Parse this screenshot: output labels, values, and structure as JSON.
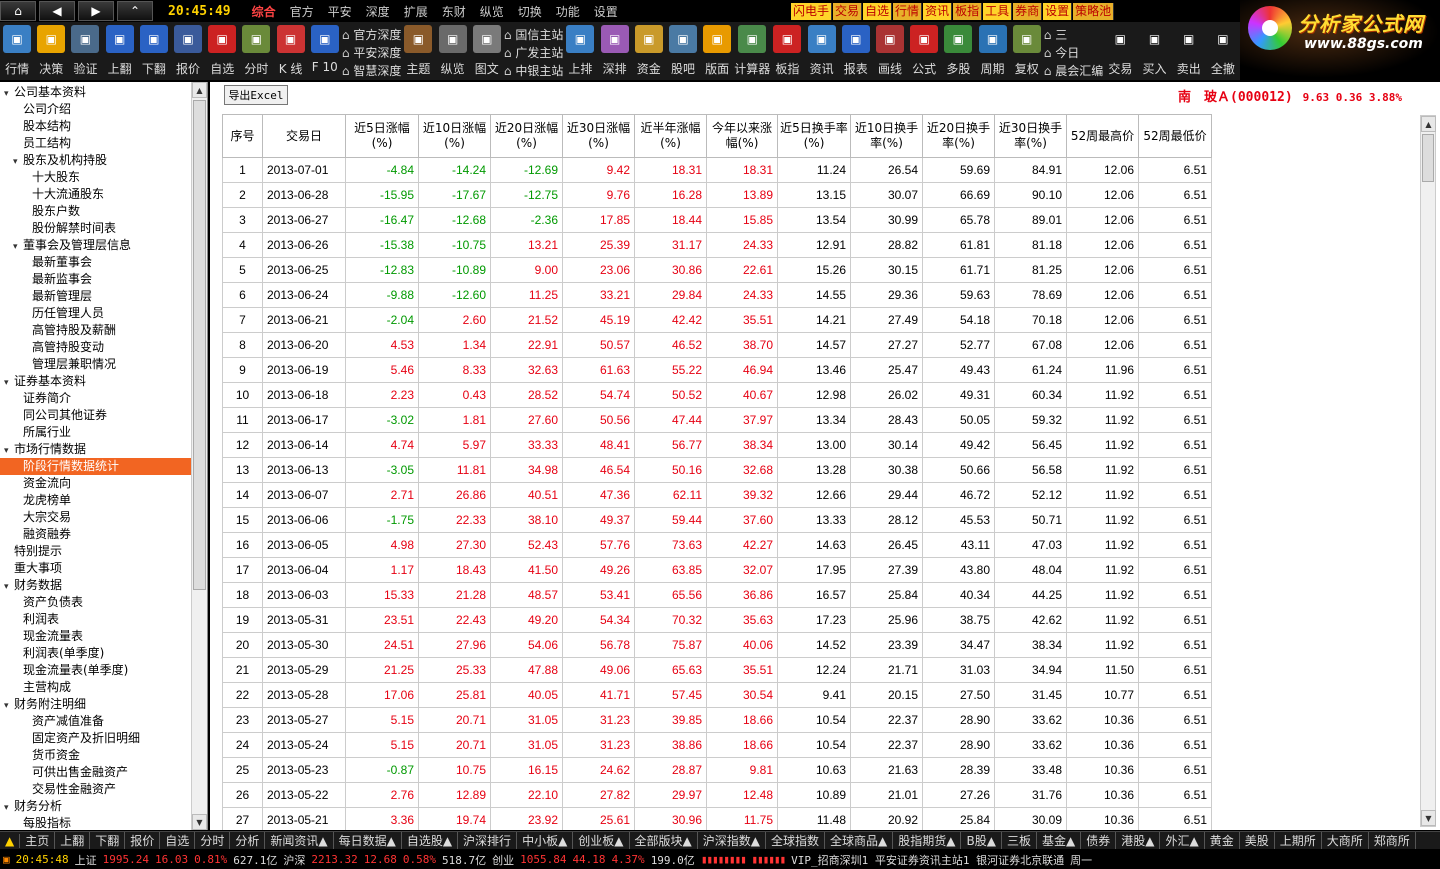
{
  "topbar": {
    "clock": "20:45:49",
    "menus": [
      "综合",
      "官方",
      "平安",
      "深度",
      "扩展",
      "东财",
      "纵览",
      "切换",
      "功能",
      "设置"
    ],
    "quick": [
      "闪电手",
      "交易",
      "自选",
      "行情",
      "资讯",
      "板指",
      "工具",
      "券商",
      "设置",
      "策略池"
    ]
  },
  "logo": {
    "title": "分析家公式网",
    "url": "www.88gs.com"
  },
  "toolbar": {
    "tools1": [
      {
        "label": "行情",
        "color": "#3a7fc4"
      },
      {
        "label": "决策",
        "color": "#e8a400"
      },
      {
        "label": "验证",
        "color": "#4a6a8a"
      },
      {
        "label": "上翻",
        "color": "#2a62c4"
      },
      {
        "label": "下翻",
        "color": "#2a62c4"
      },
      {
        "label": "报价",
        "color": "#3a5a9a"
      },
      {
        "label": "自选",
        "color": "#c22"
      },
      {
        "label": "分时",
        "color": "#6a8a3a"
      },
      {
        "label": "K 线",
        "color": "#c33"
      },
      {
        "label": "F 10",
        "color": "#2a62c4"
      }
    ],
    "triple1": [
      "官方深度",
      "平安深度",
      "智慧深度"
    ],
    "tools2": [
      {
        "label": "主题",
        "color": "#8a5a2a"
      },
      {
        "label": "纵览",
        "color": "#6a6a6a"
      },
      {
        "label": "图文",
        "color": "#7a7a7a"
      }
    ],
    "triple2": [
      "国信主站",
      "广发主站",
      "中银主站"
    ],
    "tools3": [
      {
        "label": "上排",
        "color": "#3a7fc4"
      },
      {
        "label": "深排",
        "color": "#9a5ab4"
      },
      {
        "label": "资金",
        "color": "#c99a2a"
      },
      {
        "label": "股吧",
        "color": "#4a7aa4"
      },
      {
        "label": "版面",
        "color": "#e89a00"
      },
      {
        "label": "计算器",
        "color": "#4a8a4a"
      },
      {
        "label": "板指",
        "color": "#c22"
      },
      {
        "label": "资讯",
        "color": "#3a7fc4"
      },
      {
        "label": "报表",
        "color": "#2a62c4"
      },
      {
        "label": "画线",
        "color": "#a33"
      },
      {
        "label": "公式",
        "color": "#c22"
      },
      {
        "label": "多股",
        "color": "#3a8a3a"
      },
      {
        "label": "周期",
        "color": "#2a72b4"
      },
      {
        "label": "复权",
        "color": "#6a8a3a"
      }
    ],
    "triple3": [
      "三",
      "今日",
      "晨会汇编"
    ],
    "tools4": [
      {
        "label": "交易",
        "color": "#1a1a1a"
      },
      {
        "label": "买入",
        "color": "#1a1a1a"
      },
      {
        "label": "卖出",
        "color": "#1a1a1a"
      },
      {
        "label": "全撤",
        "color": "#1a1a1a"
      }
    ]
  },
  "sidebar": {
    "items": [
      {
        "label": "公司基本资料",
        "indent": 0,
        "toggle": "▾"
      },
      {
        "label": "公司介绍",
        "indent": 1,
        "toggle": ""
      },
      {
        "label": "股本结构",
        "indent": 1,
        "toggle": ""
      },
      {
        "label": "员工结构",
        "indent": 1,
        "toggle": ""
      },
      {
        "label": "股东及机构持股",
        "indent": 1,
        "toggle": "▾"
      },
      {
        "label": "十大股东",
        "indent": 2,
        "toggle": ""
      },
      {
        "label": "十大流通股东",
        "indent": 2,
        "toggle": ""
      },
      {
        "label": "股东户数",
        "indent": 2,
        "toggle": ""
      },
      {
        "label": "股份解禁时间表",
        "indent": 2,
        "toggle": ""
      },
      {
        "label": "董事会及管理层信息",
        "indent": 1,
        "toggle": "▾"
      },
      {
        "label": "最新董事会",
        "indent": 2,
        "toggle": ""
      },
      {
        "label": "最新监事会",
        "indent": 2,
        "toggle": ""
      },
      {
        "label": "最新管理层",
        "indent": 2,
        "toggle": ""
      },
      {
        "label": "历任管理人员",
        "indent": 2,
        "toggle": ""
      },
      {
        "label": "高管持股及薪酬",
        "indent": 2,
        "toggle": ""
      },
      {
        "label": "高管持股变动",
        "indent": 2,
        "toggle": ""
      },
      {
        "label": "管理层兼职情况",
        "indent": 2,
        "toggle": ""
      },
      {
        "label": "证券基本资料",
        "indent": 0,
        "toggle": "▾"
      },
      {
        "label": "证券简介",
        "indent": 1,
        "toggle": ""
      },
      {
        "label": "同公司其他证券",
        "indent": 1,
        "toggle": ""
      },
      {
        "label": "所属行业",
        "indent": 1,
        "toggle": ""
      },
      {
        "label": "市场行情数据",
        "indent": 0,
        "toggle": "▾"
      },
      {
        "label": "阶段行情数据统计",
        "indent": 1,
        "toggle": "",
        "selected": true
      },
      {
        "label": "资金流向",
        "indent": 1,
        "toggle": ""
      },
      {
        "label": "龙虎榜单",
        "indent": 1,
        "toggle": ""
      },
      {
        "label": "大宗交易",
        "indent": 1,
        "toggle": ""
      },
      {
        "label": "融资融券",
        "indent": 1,
        "toggle": ""
      },
      {
        "label": "特别提示",
        "indent": 0,
        "toggle": ""
      },
      {
        "label": "重大事项",
        "indent": 0,
        "toggle": ""
      },
      {
        "label": "财务数据",
        "indent": 0,
        "toggle": "▾"
      },
      {
        "label": "资产负债表",
        "indent": 1,
        "toggle": ""
      },
      {
        "label": "利润表",
        "indent": 1,
        "toggle": ""
      },
      {
        "label": "现金流量表",
        "indent": 1,
        "toggle": ""
      },
      {
        "label": "利润表(单季度)",
        "indent": 1,
        "toggle": ""
      },
      {
        "label": "现金流量表(单季度)",
        "indent": 1,
        "toggle": ""
      },
      {
        "label": "主营构成",
        "indent": 1,
        "toggle": ""
      },
      {
        "label": "财务附注明细",
        "indent": 0,
        "toggle": "▾"
      },
      {
        "label": "资产减值准备",
        "indent": 2,
        "toggle": ""
      },
      {
        "label": "固定资产及折旧明细",
        "indent": 2,
        "toggle": ""
      },
      {
        "label": "货币资金",
        "indent": 2,
        "toggle": ""
      },
      {
        "label": "可供出售金融资产",
        "indent": 2,
        "toggle": ""
      },
      {
        "label": "交易性金融资产",
        "indent": 2,
        "toggle": ""
      },
      {
        "label": "财务分析",
        "indent": 0,
        "toggle": "▾"
      },
      {
        "label": "每股指标",
        "indent": 1,
        "toggle": ""
      }
    ]
  },
  "main": {
    "export_label": "导出Excel",
    "stock_name": "南　玻Ａ(000012)",
    "quote": "9.63 0.36 3.88%",
    "columns": [
      "序号",
      "交易日",
      "近5日涨幅(%)",
      "近10日涨幅(%)",
      "近20日涨幅(%)",
      "近30日涨幅(%)",
      "近半年涨幅(%)",
      "今年以来涨幅(%)",
      "近5日换手率(%)",
      "近10日换手率(%)",
      "近20日换手率(%)",
      "近30日换手率(%)",
      "52周最高价",
      "52周最低价"
    ],
    "rows": [
      [
        "1",
        "2013-07-01",
        "-4.84",
        "-14.24",
        "-12.69",
        "9.42",
        "18.31",
        "18.31",
        "11.24",
        "26.54",
        "59.69",
        "84.91",
        "12.06",
        "6.51"
      ],
      [
        "2",
        "2013-06-28",
        "-15.95",
        "-17.67",
        "-12.75",
        "9.76",
        "16.28",
        "13.89",
        "13.15",
        "30.07",
        "66.69",
        "90.10",
        "12.06",
        "6.51"
      ],
      [
        "3",
        "2013-06-27",
        "-16.47",
        "-12.68",
        "-2.36",
        "17.85",
        "18.44",
        "15.85",
        "13.54",
        "30.99",
        "65.78",
        "89.01",
        "12.06",
        "6.51"
      ],
      [
        "4",
        "2013-06-26",
        "-15.38",
        "-10.75",
        "13.21",
        "25.39",
        "31.17",
        "24.33",
        "12.91",
        "28.82",
        "61.81",
        "81.18",
        "12.06",
        "6.51"
      ],
      [
        "5",
        "2013-06-25",
        "-12.83",
        "-10.89",
        "9.00",
        "23.06",
        "30.86",
        "22.61",
        "15.26",
        "30.15",
        "61.71",
        "81.25",
        "12.06",
        "6.51"
      ],
      [
        "6",
        "2013-06-24",
        "-9.88",
        "-12.60",
        "11.25",
        "33.21",
        "29.84",
        "24.33",
        "14.55",
        "29.36",
        "59.63",
        "78.69",
        "12.06",
        "6.51"
      ],
      [
        "7",
        "2013-06-21",
        "-2.04",
        "2.60",
        "21.52",
        "45.19",
        "42.42",
        "35.51",
        "14.21",
        "27.49",
        "54.18",
        "70.18",
        "12.06",
        "6.51"
      ],
      [
        "8",
        "2013-06-20",
        "4.53",
        "1.34",
        "22.91",
        "50.57",
        "46.52",
        "38.70",
        "14.57",
        "27.27",
        "52.77",
        "67.08",
        "12.06",
        "6.51"
      ],
      [
        "9",
        "2013-06-19",
        "5.46",
        "8.33",
        "32.63",
        "61.63",
        "55.22",
        "46.94",
        "13.46",
        "25.47",
        "49.43",
        "61.24",
        "11.96",
        "6.51"
      ],
      [
        "10",
        "2013-06-18",
        "2.23",
        "0.43",
        "28.52",
        "54.74",
        "50.52",
        "40.67",
        "12.98",
        "26.02",
        "49.31",
        "60.34",
        "11.92",
        "6.51"
      ],
      [
        "11",
        "2013-06-17",
        "-3.02",
        "1.81",
        "27.60",
        "50.56",
        "47.44",
        "37.97",
        "13.34",
        "28.43",
        "50.05",
        "59.32",
        "11.92",
        "6.51"
      ],
      [
        "12",
        "2013-06-14",
        "4.74",
        "5.97",
        "33.33",
        "48.41",
        "56.77",
        "38.34",
        "13.00",
        "30.14",
        "49.42",
        "56.45",
        "11.92",
        "6.51"
      ],
      [
        "13",
        "2013-06-13",
        "-3.05",
        "11.81",
        "34.98",
        "46.54",
        "50.16",
        "32.68",
        "13.28",
        "30.38",
        "50.66",
        "56.58",
        "11.92",
        "6.51"
      ],
      [
        "14",
        "2013-06-07",
        "2.71",
        "26.86",
        "40.51",
        "47.36",
        "62.11",
        "39.32",
        "12.66",
        "29.44",
        "46.72",
        "52.12",
        "11.92",
        "6.51"
      ],
      [
        "15",
        "2013-06-06",
        "-1.75",
        "22.33",
        "38.10",
        "49.37",
        "59.44",
        "37.60",
        "13.33",
        "28.12",
        "45.53",
        "50.71",
        "11.92",
        "6.51"
      ],
      [
        "16",
        "2013-06-05",
        "4.98",
        "27.30",
        "52.43",
        "57.76",
        "73.63",
        "42.27",
        "14.63",
        "26.45",
        "43.11",
        "47.03",
        "11.92",
        "6.51"
      ],
      [
        "17",
        "2013-06-04",
        "1.17",
        "18.43",
        "41.50",
        "49.26",
        "63.85",
        "32.07",
        "17.95",
        "27.39",
        "43.80",
        "48.04",
        "11.92",
        "6.51"
      ],
      [
        "18",
        "2013-06-03",
        "15.33",
        "21.28",
        "48.57",
        "53.41",
        "65.56",
        "36.86",
        "16.57",
        "25.84",
        "40.34",
        "44.25",
        "11.92",
        "6.51"
      ],
      [
        "19",
        "2013-05-31",
        "23.51",
        "22.43",
        "49.20",
        "54.34",
        "70.32",
        "35.63",
        "17.23",
        "25.96",
        "38.75",
        "42.62",
        "11.92",
        "6.51"
      ],
      [
        "20",
        "2013-05-30",
        "24.51",
        "27.96",
        "54.06",
        "56.78",
        "75.87",
        "40.06",
        "14.52",
        "23.39",
        "34.47",
        "38.34",
        "11.92",
        "6.51"
      ],
      [
        "21",
        "2013-05-29",
        "21.25",
        "25.33",
        "47.88",
        "49.06",
        "65.63",
        "35.51",
        "12.24",
        "21.71",
        "31.03",
        "34.94",
        "11.50",
        "6.51"
      ],
      [
        "22",
        "2013-05-28",
        "17.06",
        "25.81",
        "40.05",
        "41.71",
        "57.45",
        "30.54",
        "9.41",
        "20.15",
        "27.50",
        "31.45",
        "10.77",
        "6.51"
      ],
      [
        "23",
        "2013-05-27",
        "5.15",
        "20.71",
        "31.05",
        "31.23",
        "39.85",
        "18.66",
        "10.54",
        "22.37",
        "28.90",
        "33.62",
        "10.36",
        "6.51"
      ],
      [
        "24",
        "2013-05-24",
        "5.15",
        "20.71",
        "31.05",
        "31.23",
        "38.86",
        "18.66",
        "10.54",
        "22.37",
        "28.90",
        "33.62",
        "10.36",
        "6.51"
      ],
      [
        "25",
        "2013-05-23",
        "-0.87",
        "10.75",
        "16.15",
        "24.62",
        "28.87",
        "9.81",
        "10.63",
        "21.63",
        "28.39",
        "33.48",
        "10.36",
        "6.51"
      ],
      [
        "26",
        "2013-05-22",
        "2.76",
        "12.89",
        "22.10",
        "27.82",
        "29.97",
        "12.48",
        "10.89",
        "21.01",
        "27.26",
        "31.76",
        "10.36",
        "6.51"
      ],
      [
        "27",
        "2013-05-21",
        "3.36",
        "19.74",
        "23.92",
        "25.61",
        "30.96",
        "11.75",
        "11.48",
        "20.92",
        "25.84",
        "30.09",
        "10.36",
        "6.51"
      ]
    ]
  },
  "bottombar": [
    "主页",
    "上翻",
    "下翻",
    "报价",
    "自选",
    "分时",
    "分析",
    "新闻资讯▲",
    "每日数据▲",
    "自选股▲",
    "沪深排行",
    "中小板▲",
    "创业板▲",
    "全部版块▲",
    "沪深指数▲",
    "全球指数",
    "全球商品▲",
    "股指期货▲",
    "B股▲",
    "三板",
    "基金▲",
    "债券",
    "港股▲",
    "外汇▲",
    "黄金",
    "美股",
    "上期所",
    "大商所",
    "郑商所"
  ],
  "status": {
    "time": "20:45:48",
    "sh_label": "上证",
    "sh_index": "1995.24",
    "sh_chg": "16.03",
    "sh_pct": "0.81%",
    "sh_amt": "627.1亿",
    "hs_label": "沪深",
    "hs_index": "2213.32",
    "hs_chg": "12.68",
    "hs_pct": "0.58%",
    "hs_amt": "518.7亿",
    "cy_label": "创业",
    "cy_index": "1055.84",
    "cy_chg": "44.18",
    "cy_pct": "4.37%",
    "cy_amt": "199.0亿",
    "vip": "VIP_招商深圳1  平安证券资讯主站1  银河证券北京联通",
    "weekday": "周一"
  }
}
